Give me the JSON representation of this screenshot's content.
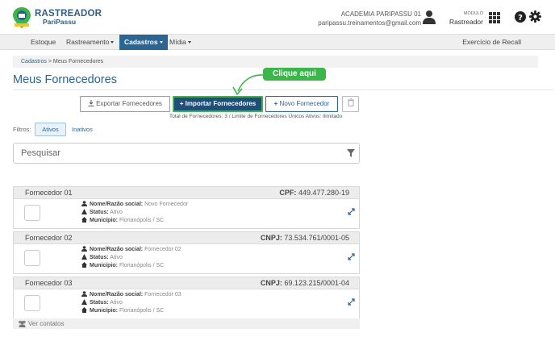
{
  "header": {
    "brand_line1": "RASTREADOR",
    "brand_line2": "PariPassu",
    "account_name": "ACADEMIA PARIPASSU 01",
    "account_email": "paripassu.treinamentos@gmail.com",
    "module_label": "MÓDULO",
    "module_value": "Rastreador",
    "brand_color": "#2a6593"
  },
  "nav": {
    "items": [
      {
        "label": "Estoque",
        "dropdown": false,
        "active": false
      },
      {
        "label": "Rastreamento",
        "dropdown": true,
        "active": false
      },
      {
        "label": "Cadastros",
        "dropdown": true,
        "active": true
      },
      {
        "label": "Mídia",
        "dropdown": true,
        "active": false
      }
    ],
    "right_label": "Exercício de Recall"
  },
  "breadcrumb": {
    "parent": "Cadastros",
    "separator": ">",
    "current": "Meus Fornecedores"
  },
  "page": {
    "title": "Meus Fornecedores",
    "callout": "Clique aqui",
    "callout_color": "#3cb54a"
  },
  "toolbar": {
    "export_label": "Exportar Fornecedores",
    "import_label": "Importar Fornecedores",
    "new_label": "Novo Fornecedor",
    "total_text": "Total de Fornecedores: 3 / Limite de Fornecedores Únicos Ativos: Ilimitado"
  },
  "filters": {
    "label": "Filtros:",
    "active_label": "Ativos",
    "inactive_label": "Inativos"
  },
  "search": {
    "placeholder": "Pesquisar"
  },
  "field_labels": {
    "name": "Nome/Razão social:",
    "status": "Status:",
    "city": "Município:"
  },
  "suppliers": [
    {
      "title": "Fornecedor 01",
      "doc_type": "CPF:",
      "doc_value": "449.477.280-19",
      "name": "Novo Fornecedor",
      "status": "Ativo",
      "city": "Florianópolis / SC"
    },
    {
      "title": "Fornecedor 02",
      "doc_type": "CNPJ:",
      "doc_value": "73.534.761/0001-05",
      "name": "Fornecedor 02",
      "status": "Ativo",
      "city": "Florianópolis / SC"
    },
    {
      "title": "Fornecedor 03",
      "doc_type": "CNPJ:",
      "doc_value": "69.123.215/0001-04",
      "name": "Fornecedor 03",
      "status": "Ativo",
      "city": "Florianópolis / SC"
    }
  ],
  "contacts_label": "Ver contatos"
}
